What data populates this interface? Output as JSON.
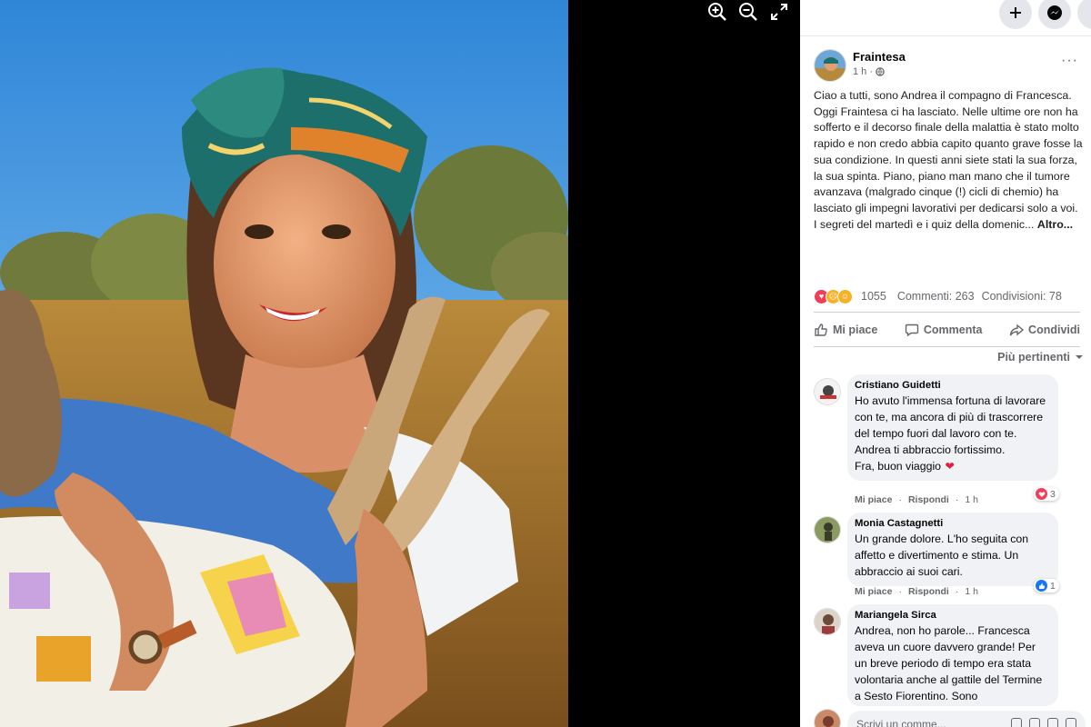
{
  "viewer": {
    "toolbar": [
      "zoom-in",
      "zoom-out",
      "fullscreen"
    ]
  },
  "header": {
    "create_icon": "plus-icon",
    "messenger_icon": "messenger-icon"
  },
  "post": {
    "author": "Fraintesa",
    "time": "1 h ·",
    "privacy_icon": "globe-icon",
    "text": "Ciao a tutti, sono Andrea il compagno di Francesca. Oggi Fraintesa ci ha lasciato. Nelle ultime ore non ha sofferto e il decorso finale della malattia è stato molto rapido e non credo abbia capito quanto grave fosse la sua condizione. In questi anni siete stati la sua forza, la sua spinta. Piano, piano man mano che il tumore avanzava (malgrado cinque (!) cicli di chemio) ha lasciato gli impegni lavorativi per dedicarsi solo a voi. I segreti del martedì e i quiz della domenic...",
    "more_link": "Altro...",
    "reaction_count": "1055",
    "comments_label": "Commenti: 263",
    "shares_label": "Condivisioni: 78"
  },
  "actions": {
    "like": "Mi piace",
    "comment": "Commenta",
    "share": "Condividi"
  },
  "sort_label": "Più pertinenti",
  "comments": [
    {
      "name": "Cristiano Guidetti",
      "text": "Ho avuto l'immensa fortuna di lavorare con te, ma ancora di più di trascorrere del tempo fuori dal lavoro con te. Andrea ti abbraccio fortissimo.\nFra, buon viaggio",
      "emoji": "❤",
      "like": "Mi piace",
      "reply": "Rispondi",
      "time": "1 h",
      "reaction_count": "3",
      "reaction_type": "love"
    },
    {
      "name": "Monia Castagnetti",
      "text": "Un grande dolore. L'ho seguita con affetto e divertimento e stima. Un abbraccio ai suoi cari.",
      "like": "Mi piace",
      "reply": "Rispondi",
      "time": "1 h",
      "reaction_count": "1",
      "reaction_type": "like"
    },
    {
      "name": "Mariangela Sirca",
      "text": "Andrea, non ho parole... Francesca aveva un cuore davvero grande! Per un breve periodo di tempo era stata volontaria anche al gattile del Termine a Sesto Fiorentino. Sono"
    }
  ],
  "compose_placeholder": "Scrivi un comme..."
}
